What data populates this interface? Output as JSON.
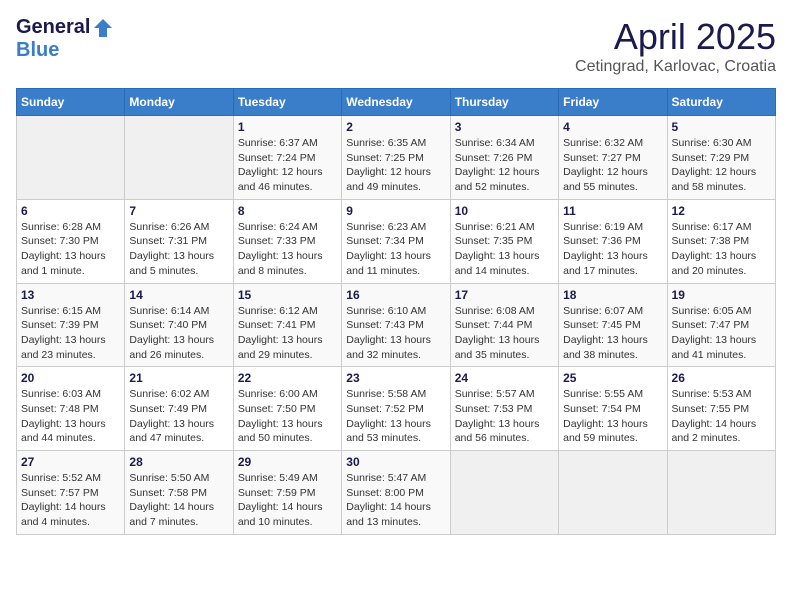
{
  "header": {
    "logo_general": "General",
    "logo_blue": "Blue",
    "title": "April 2025",
    "subtitle": "Cetingrad, Karlovac, Croatia"
  },
  "weekdays": [
    "Sunday",
    "Monday",
    "Tuesday",
    "Wednesday",
    "Thursday",
    "Friday",
    "Saturday"
  ],
  "weeks": [
    [
      {
        "day": "",
        "info": ""
      },
      {
        "day": "",
        "info": ""
      },
      {
        "day": "1",
        "info": "Sunrise: 6:37 AM\nSunset: 7:24 PM\nDaylight: 12 hours and 46 minutes."
      },
      {
        "day": "2",
        "info": "Sunrise: 6:35 AM\nSunset: 7:25 PM\nDaylight: 12 hours and 49 minutes."
      },
      {
        "day": "3",
        "info": "Sunrise: 6:34 AM\nSunset: 7:26 PM\nDaylight: 12 hours and 52 minutes."
      },
      {
        "day": "4",
        "info": "Sunrise: 6:32 AM\nSunset: 7:27 PM\nDaylight: 12 hours and 55 minutes."
      },
      {
        "day": "5",
        "info": "Sunrise: 6:30 AM\nSunset: 7:29 PM\nDaylight: 12 hours and 58 minutes."
      }
    ],
    [
      {
        "day": "6",
        "info": "Sunrise: 6:28 AM\nSunset: 7:30 PM\nDaylight: 13 hours and 1 minute."
      },
      {
        "day": "7",
        "info": "Sunrise: 6:26 AM\nSunset: 7:31 PM\nDaylight: 13 hours and 5 minutes."
      },
      {
        "day": "8",
        "info": "Sunrise: 6:24 AM\nSunset: 7:33 PM\nDaylight: 13 hours and 8 minutes."
      },
      {
        "day": "9",
        "info": "Sunrise: 6:23 AM\nSunset: 7:34 PM\nDaylight: 13 hours and 11 minutes."
      },
      {
        "day": "10",
        "info": "Sunrise: 6:21 AM\nSunset: 7:35 PM\nDaylight: 13 hours and 14 minutes."
      },
      {
        "day": "11",
        "info": "Sunrise: 6:19 AM\nSunset: 7:36 PM\nDaylight: 13 hours and 17 minutes."
      },
      {
        "day": "12",
        "info": "Sunrise: 6:17 AM\nSunset: 7:38 PM\nDaylight: 13 hours and 20 minutes."
      }
    ],
    [
      {
        "day": "13",
        "info": "Sunrise: 6:15 AM\nSunset: 7:39 PM\nDaylight: 13 hours and 23 minutes."
      },
      {
        "day": "14",
        "info": "Sunrise: 6:14 AM\nSunset: 7:40 PM\nDaylight: 13 hours and 26 minutes."
      },
      {
        "day": "15",
        "info": "Sunrise: 6:12 AM\nSunset: 7:41 PM\nDaylight: 13 hours and 29 minutes."
      },
      {
        "day": "16",
        "info": "Sunrise: 6:10 AM\nSunset: 7:43 PM\nDaylight: 13 hours and 32 minutes."
      },
      {
        "day": "17",
        "info": "Sunrise: 6:08 AM\nSunset: 7:44 PM\nDaylight: 13 hours and 35 minutes."
      },
      {
        "day": "18",
        "info": "Sunrise: 6:07 AM\nSunset: 7:45 PM\nDaylight: 13 hours and 38 minutes."
      },
      {
        "day": "19",
        "info": "Sunrise: 6:05 AM\nSunset: 7:47 PM\nDaylight: 13 hours and 41 minutes."
      }
    ],
    [
      {
        "day": "20",
        "info": "Sunrise: 6:03 AM\nSunset: 7:48 PM\nDaylight: 13 hours and 44 minutes."
      },
      {
        "day": "21",
        "info": "Sunrise: 6:02 AM\nSunset: 7:49 PM\nDaylight: 13 hours and 47 minutes."
      },
      {
        "day": "22",
        "info": "Sunrise: 6:00 AM\nSunset: 7:50 PM\nDaylight: 13 hours and 50 minutes."
      },
      {
        "day": "23",
        "info": "Sunrise: 5:58 AM\nSunset: 7:52 PM\nDaylight: 13 hours and 53 minutes."
      },
      {
        "day": "24",
        "info": "Sunrise: 5:57 AM\nSunset: 7:53 PM\nDaylight: 13 hours and 56 minutes."
      },
      {
        "day": "25",
        "info": "Sunrise: 5:55 AM\nSunset: 7:54 PM\nDaylight: 13 hours and 59 minutes."
      },
      {
        "day": "26",
        "info": "Sunrise: 5:53 AM\nSunset: 7:55 PM\nDaylight: 14 hours and 2 minutes."
      }
    ],
    [
      {
        "day": "27",
        "info": "Sunrise: 5:52 AM\nSunset: 7:57 PM\nDaylight: 14 hours and 4 minutes."
      },
      {
        "day": "28",
        "info": "Sunrise: 5:50 AM\nSunset: 7:58 PM\nDaylight: 14 hours and 7 minutes."
      },
      {
        "day": "29",
        "info": "Sunrise: 5:49 AM\nSunset: 7:59 PM\nDaylight: 14 hours and 10 minutes."
      },
      {
        "day": "30",
        "info": "Sunrise: 5:47 AM\nSunset: 8:00 PM\nDaylight: 14 hours and 13 minutes."
      },
      {
        "day": "",
        "info": ""
      },
      {
        "day": "",
        "info": ""
      },
      {
        "day": "",
        "info": ""
      }
    ]
  ]
}
